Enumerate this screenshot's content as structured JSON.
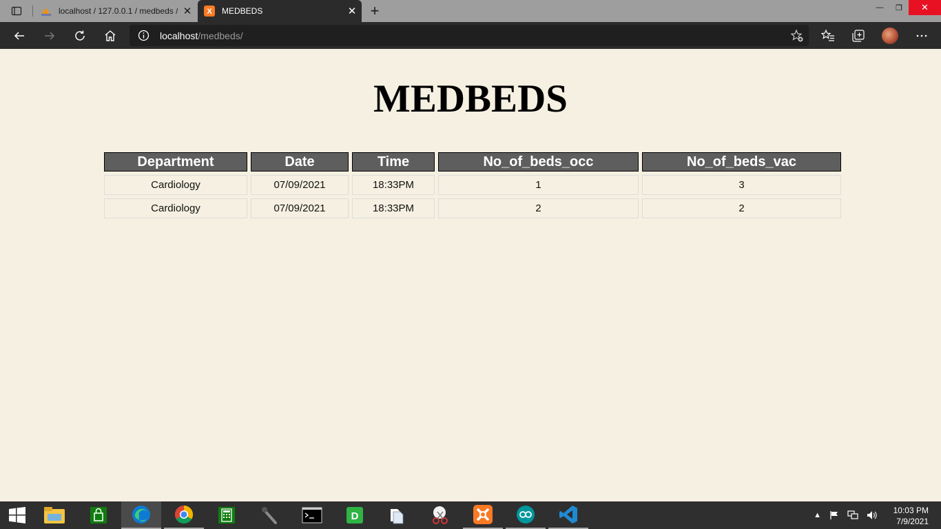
{
  "browser": {
    "tabs": [
      {
        "title": "localhost / 127.0.0.1 / medbeds /",
        "icon": "phpmyadmin-icon"
      },
      {
        "title": "MEDBEDS",
        "icon": "xampp-icon"
      }
    ],
    "url_host": "localhost",
    "url_path": "/medbeds/"
  },
  "page": {
    "heading": "MEDBEDS",
    "table": {
      "headers": [
        "Department",
        "Date",
        "Time",
        "No_of_beds_occ",
        "No_of_beds_vac"
      ],
      "rows": [
        [
          "Cardiology",
          "07/09/2021",
          "18:33PM",
          "1",
          "3"
        ],
        [
          "Cardiology",
          "07/09/2021",
          "18:33PM",
          "2",
          "2"
        ]
      ]
    }
  },
  "taskbar": {
    "apps": [
      "file-explorer-icon",
      "store-icon",
      "edge-icon",
      "chrome-icon",
      "calculator-icon",
      "mic-icon",
      "cmd-icon",
      "dbeaver-icon",
      "files-icon",
      "snipping-tool-icon",
      "xampp-icon",
      "arduino-icon",
      "vscode-icon"
    ],
    "time": "10:03 PM",
    "date": "7/9/2021"
  },
  "colors": {
    "page_background": "#f5f0e1",
    "header_cell": "#5e5e5e",
    "browser_chrome": "#2b2b2b"
  }
}
